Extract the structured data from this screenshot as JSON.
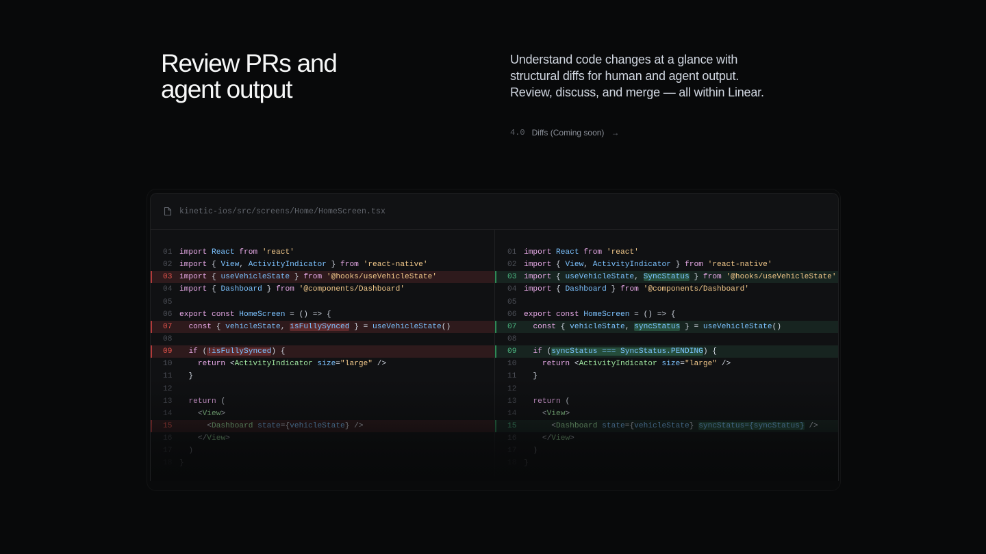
{
  "hero": {
    "title_line1": "Review PRs and",
    "title_line2": "agent output",
    "desc_line1": "Understand code changes at a glance with",
    "desc_line2": "structural diffs for human and agent output.",
    "desc_line3": "Review, discuss, and merge — all within Linear.",
    "release_version": "4.0",
    "release_label": "Diffs (Coming soon)",
    "release_arrow": "→"
  },
  "diff": {
    "file_path": "kinetic-ios/src/screens/Home/HomeScreen.tsx",
    "left": [
      {
        "n": "01",
        "type": "ctx",
        "tokens": [
          [
            "k",
            "import "
          ],
          [
            "t",
            "React"
          ],
          [
            "k",
            " from "
          ],
          [
            "s",
            "'react'"
          ]
        ]
      },
      {
        "n": "02",
        "type": "ctx",
        "tokens": [
          [
            "k",
            "import "
          ],
          [
            "p",
            "{ "
          ],
          [
            "t",
            "View"
          ],
          [
            "p",
            ", "
          ],
          [
            "t",
            "ActivityIndicator"
          ],
          [
            "p",
            " } "
          ],
          [
            "k",
            "from "
          ],
          [
            "s",
            "'react-native'"
          ]
        ]
      },
      {
        "n": "03",
        "type": "del",
        "tokens": [
          [
            "k",
            "import "
          ],
          [
            "p",
            "{ "
          ],
          [
            "t",
            "useVehicleState"
          ],
          [
            "p",
            " } "
          ],
          [
            "k",
            "from "
          ],
          [
            "s",
            "'@hooks/useVehicleState'"
          ]
        ]
      },
      {
        "n": "04",
        "type": "ctx",
        "tokens": [
          [
            "k",
            "import "
          ],
          [
            "p",
            "{ "
          ],
          [
            "t",
            "Dashboard"
          ],
          [
            "p",
            " } "
          ],
          [
            "k",
            "from "
          ],
          [
            "s",
            "'@components/Dashboard'"
          ]
        ]
      },
      {
        "n": "05",
        "type": "ctx",
        "tokens": []
      },
      {
        "n": "06",
        "type": "ctx",
        "tokens": [
          [
            "k",
            "export const "
          ],
          [
            "t",
            "HomeScreen"
          ],
          [
            "p",
            " = () => {"
          ]
        ]
      },
      {
        "n": "07",
        "type": "del",
        "tokens": [
          [
            "p",
            "  "
          ],
          [
            "k",
            "const "
          ],
          [
            "p",
            "{ "
          ],
          [
            "t",
            "vehicleState"
          ],
          [
            "p",
            ", "
          ],
          [
            "hd",
            "isFullySynced"
          ],
          [
            "p",
            " } = "
          ],
          [
            "t",
            "useVehicleState"
          ],
          [
            "p",
            "()"
          ]
        ]
      },
      {
        "n": "08",
        "type": "ctx",
        "tokens": []
      },
      {
        "n": "09",
        "type": "del",
        "tokens": [
          [
            "p",
            "  "
          ],
          [
            "k",
            "if "
          ],
          [
            "p",
            "("
          ],
          [
            "hd",
            "!isFullySynced"
          ],
          [
            "p",
            ") {"
          ]
        ]
      },
      {
        "n": "10",
        "type": "ctx",
        "tokens": [
          [
            "p",
            "    "
          ],
          [
            "k",
            "return "
          ],
          [
            "p",
            "<"
          ],
          [
            "g",
            "ActivityIndicator"
          ],
          [
            "t",
            " size"
          ],
          [
            "p",
            "="
          ],
          [
            "s",
            "\"large\""
          ],
          [
            "p",
            " />"
          ]
        ]
      },
      {
        "n": "11",
        "type": "ctx",
        "tokens": [
          [
            "p",
            "  }"
          ]
        ]
      },
      {
        "n": "12",
        "type": "ctx",
        "tokens": []
      },
      {
        "n": "13",
        "type": "ctx",
        "tokens": [
          [
            "p",
            "  "
          ],
          [
            "k",
            "return "
          ],
          [
            "p",
            "("
          ]
        ]
      },
      {
        "n": "14",
        "type": "ctx",
        "tokens": [
          [
            "p",
            "    <"
          ],
          [
            "g",
            "View"
          ],
          [
            "p",
            ">"
          ]
        ]
      },
      {
        "n": "15",
        "type": "del",
        "tokens": [
          [
            "p",
            "      <"
          ],
          [
            "g",
            "Dashboard"
          ],
          [
            "t",
            " state"
          ],
          [
            "p",
            "={"
          ],
          [
            "t",
            "vehicleState"
          ],
          [
            "p",
            "} />"
          ]
        ]
      },
      {
        "n": "16",
        "type": "ctx",
        "tokens": [
          [
            "p",
            "    </"
          ],
          [
            "g",
            "View"
          ],
          [
            "p",
            ">"
          ]
        ]
      },
      {
        "n": "17",
        "type": "ctx",
        "tokens": [
          [
            "p",
            "  )"
          ]
        ]
      },
      {
        "n": "18",
        "type": "ctx",
        "tokens": [
          [
            "p",
            "}"
          ]
        ]
      }
    ],
    "right": [
      {
        "n": "01",
        "type": "ctx",
        "tokens": [
          [
            "k",
            "import "
          ],
          [
            "t",
            "React"
          ],
          [
            "k",
            " from "
          ],
          [
            "s",
            "'react'"
          ]
        ]
      },
      {
        "n": "02",
        "type": "ctx",
        "tokens": [
          [
            "k",
            "import "
          ],
          [
            "p",
            "{ "
          ],
          [
            "t",
            "View"
          ],
          [
            "p",
            ", "
          ],
          [
            "t",
            "ActivityIndicator"
          ],
          [
            "p",
            " } "
          ],
          [
            "k",
            "from "
          ],
          [
            "s",
            "'react-native'"
          ]
        ]
      },
      {
        "n": "03",
        "type": "add",
        "tokens": [
          [
            "k",
            "import "
          ],
          [
            "p",
            "{ "
          ],
          [
            "t",
            "useVehicleState"
          ],
          [
            "p",
            ", "
          ],
          [
            "ha",
            "SyncStatus"
          ],
          [
            "p",
            " } "
          ],
          [
            "k",
            "from "
          ],
          [
            "s",
            "'@hooks/useVehicleState'"
          ]
        ]
      },
      {
        "n": "04",
        "type": "ctx",
        "tokens": [
          [
            "k",
            "import "
          ],
          [
            "p",
            "{ "
          ],
          [
            "t",
            "Dashboard"
          ],
          [
            "p",
            " } "
          ],
          [
            "k",
            "from "
          ],
          [
            "s",
            "'@components/Dashboard'"
          ]
        ]
      },
      {
        "n": "05",
        "type": "ctx",
        "tokens": []
      },
      {
        "n": "06",
        "type": "ctx",
        "tokens": [
          [
            "k",
            "export const "
          ],
          [
            "t",
            "HomeScreen"
          ],
          [
            "p",
            " = () => {"
          ]
        ]
      },
      {
        "n": "07",
        "type": "add",
        "tokens": [
          [
            "p",
            "  "
          ],
          [
            "k",
            "const "
          ],
          [
            "p",
            "{ "
          ],
          [
            "t",
            "vehicleState"
          ],
          [
            "p",
            ", "
          ],
          [
            "ha",
            "syncStatus"
          ],
          [
            "p",
            " } = "
          ],
          [
            "t",
            "useVehicleState"
          ],
          [
            "p",
            "()"
          ]
        ]
      },
      {
        "n": "08",
        "type": "ctx",
        "tokens": []
      },
      {
        "n": "09",
        "type": "add",
        "tokens": [
          [
            "p",
            "  "
          ],
          [
            "k",
            "if "
          ],
          [
            "p",
            "("
          ],
          [
            "ha",
            "syncStatus === SyncStatus.PENDING"
          ],
          [
            "p",
            ") {"
          ]
        ]
      },
      {
        "n": "10",
        "type": "ctx",
        "tokens": [
          [
            "p",
            "    "
          ],
          [
            "k",
            "return "
          ],
          [
            "p",
            "<"
          ],
          [
            "g",
            "ActivityIndicator"
          ],
          [
            "t",
            " size"
          ],
          [
            "p",
            "="
          ],
          [
            "s",
            "\"large\""
          ],
          [
            "p",
            " />"
          ]
        ]
      },
      {
        "n": "11",
        "type": "ctx",
        "tokens": [
          [
            "p",
            "  }"
          ]
        ]
      },
      {
        "n": "12",
        "type": "ctx",
        "tokens": []
      },
      {
        "n": "13",
        "type": "ctx",
        "tokens": [
          [
            "p",
            "  "
          ],
          [
            "k",
            "return "
          ],
          [
            "p",
            "("
          ]
        ]
      },
      {
        "n": "14",
        "type": "ctx",
        "tokens": [
          [
            "p",
            "    <"
          ],
          [
            "g",
            "View"
          ],
          [
            "p",
            ">"
          ]
        ]
      },
      {
        "n": "15",
        "type": "add",
        "tokens": [
          [
            "p",
            "      <"
          ],
          [
            "g",
            "Dashboard"
          ],
          [
            "t",
            " state"
          ],
          [
            "p",
            "={"
          ],
          [
            "t",
            "vehicleState"
          ],
          [
            "p",
            "} "
          ],
          [
            "ha",
            "syncStatus={syncStatus}"
          ],
          [
            "p",
            " />"
          ]
        ]
      },
      {
        "n": "16",
        "type": "ctx",
        "tokens": [
          [
            "p",
            "    </"
          ],
          [
            "g",
            "View"
          ],
          [
            "p",
            ">"
          ]
        ]
      },
      {
        "n": "17",
        "type": "ctx",
        "tokens": [
          [
            "p",
            "  )"
          ]
        ]
      },
      {
        "n": "18",
        "type": "ctx",
        "tokens": [
          [
            "p",
            "}"
          ]
        ]
      }
    ]
  },
  "colors": {
    "background": "#08090a",
    "deletion": "#e5534b",
    "addition": "#4cb782"
  }
}
